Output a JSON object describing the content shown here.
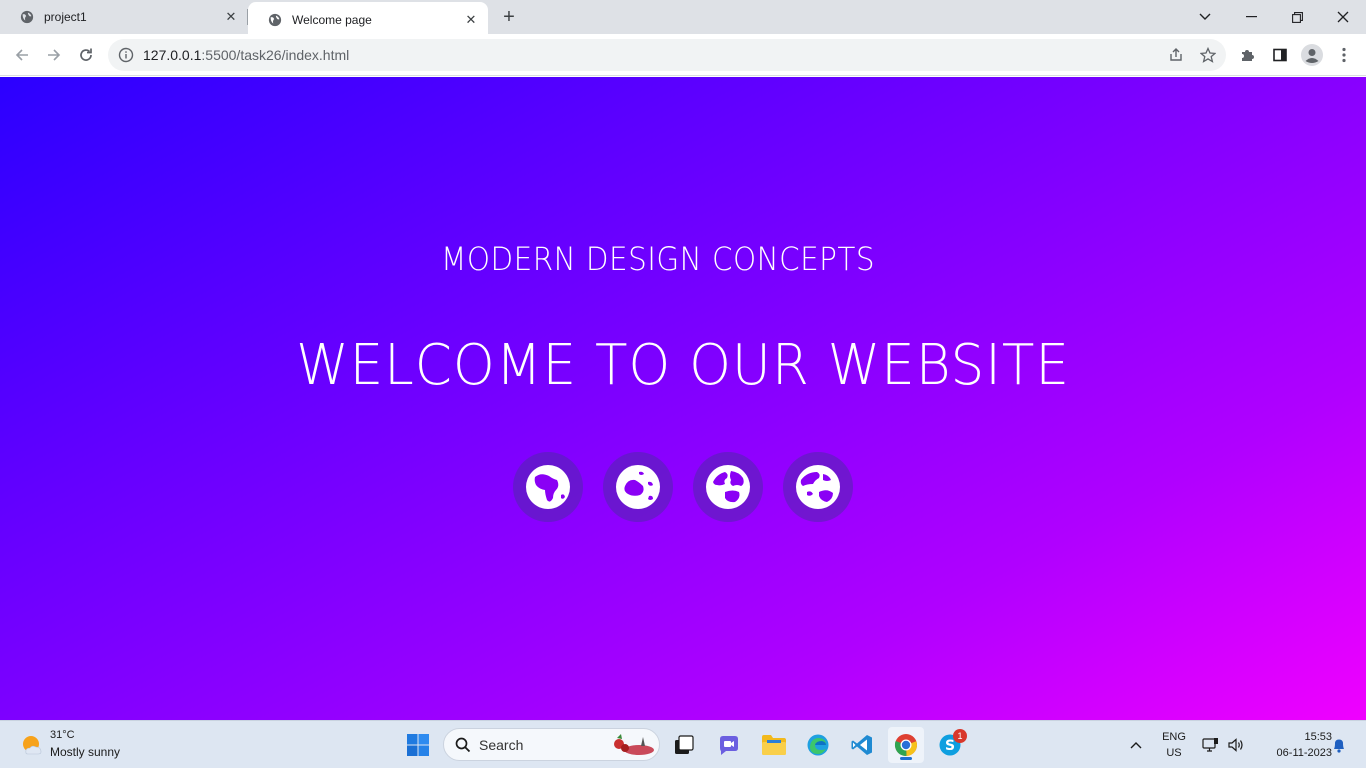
{
  "browser": {
    "tabs": [
      {
        "title": "project1",
        "active": false
      },
      {
        "title": "Welcome page",
        "active": true
      }
    ],
    "url_host": "127.0.0.1",
    "url_path": ":5500/task26/index.html"
  },
  "page": {
    "subtitle": "MODERN DESIGN CONCEPTS",
    "headline": "WELCOME TO OUR WEBSITE",
    "globe_icons": [
      "globe-africa-icon",
      "globe-oceania-icon",
      "globe-europe-icon",
      "globe-asia-icon"
    ],
    "gradient_colors": [
      "#2b00ff",
      "#7a00ff",
      "#f000ff"
    ]
  },
  "taskbar": {
    "weather_temp": "31°C",
    "weather_desc": "Mostly sunny",
    "search_placeholder": "Search",
    "lang_line1": "ENG",
    "lang_line2": "US",
    "time": "15:53",
    "date": "06-11-2023",
    "skype_badge": "1"
  }
}
